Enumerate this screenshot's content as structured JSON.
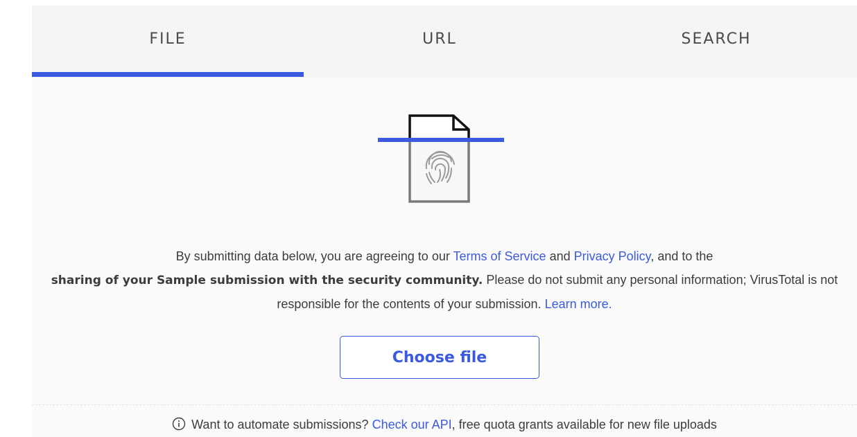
{
  "tabs": {
    "file": "FILE",
    "url": "URL",
    "search": "SEARCH",
    "active": "file"
  },
  "illustration": {
    "icon": "file-fingerprint-icon",
    "accent_color": "#3b5ae0"
  },
  "terms": {
    "prefix": "By submitting data below, you are agreeing to our ",
    "terms_link": "Terms of Service",
    "and": " and ",
    "privacy_link": "Privacy Policy",
    "after_privacy": ", and to the",
    "bold": "sharing of your Sample submission with the security community.",
    "after_bold": " Please do not submit any personal information; VirusTotal is not responsible for the contents of your submission. ",
    "learn_more": "Learn more."
  },
  "upload": {
    "button_label": "Choose file"
  },
  "api_note": {
    "icon": "info-icon",
    "prefix": "Want to automate submissions? ",
    "link": "Check our API",
    "suffix": ", free quota grants available for new file uploads"
  },
  "colors": {
    "accent": "#3b5ae0",
    "tab_background": "#f4f4f4",
    "panel_background": "#fafafa"
  }
}
